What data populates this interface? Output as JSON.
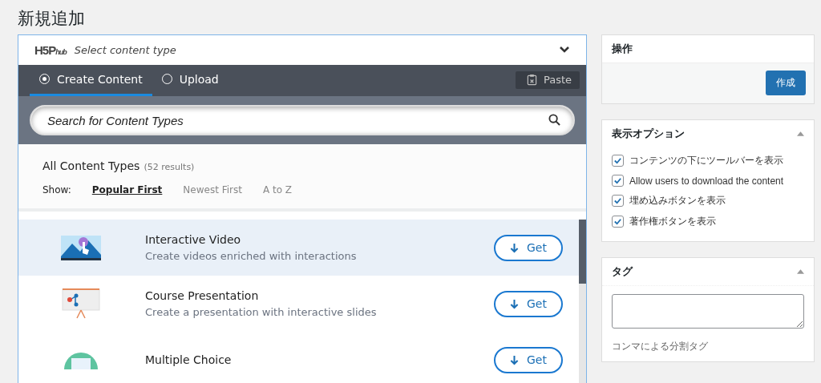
{
  "page_title": "新規追加",
  "hub": {
    "logo": "H5P",
    "logo_sub": "hub",
    "title": "Select content type",
    "expanded": true,
    "tabs": [
      {
        "label": "Create Content",
        "selected": true
      },
      {
        "label": "Upload",
        "selected": false
      }
    ],
    "paste_button": "Paste",
    "search": {
      "placeholder": "Search for Content Types"
    },
    "list_title": "All Content Types",
    "result_count": "(52 results)",
    "show_label": "Show:",
    "sort_options": [
      {
        "label": "Popular First",
        "selected": true
      },
      {
        "label": "Newest First",
        "selected": false
      },
      {
        "label": "A to Z",
        "selected": false
      }
    ],
    "items": [
      {
        "kind": "video",
        "title": "Interactive Video",
        "description": "Create videos enriched with interactions",
        "button": "Get",
        "highlighted": true
      },
      {
        "kind": "presentation",
        "title": "Course Presentation",
        "description": "Create a presentation with interactive slides",
        "button": "Get",
        "highlighted": false
      },
      {
        "kind": "choice",
        "title": "Multiple Choice",
        "button": "Get",
        "highlighted": false
      }
    ]
  },
  "publish_box": {
    "title": "操作",
    "button": "作成"
  },
  "display_options": {
    "title": "表示オプション",
    "options": [
      {
        "label": "コンテンツの下にツールバーを表示",
        "checked": true
      },
      {
        "label": "Allow users to download the content",
        "checked": true
      },
      {
        "label": "埋め込みボタンを表示",
        "checked": true
      },
      {
        "label": "著作権ボタンを表示",
        "checked": true
      }
    ]
  },
  "tags_box": {
    "title": "タグ",
    "hint": "コンマによる分割タグ"
  }
}
